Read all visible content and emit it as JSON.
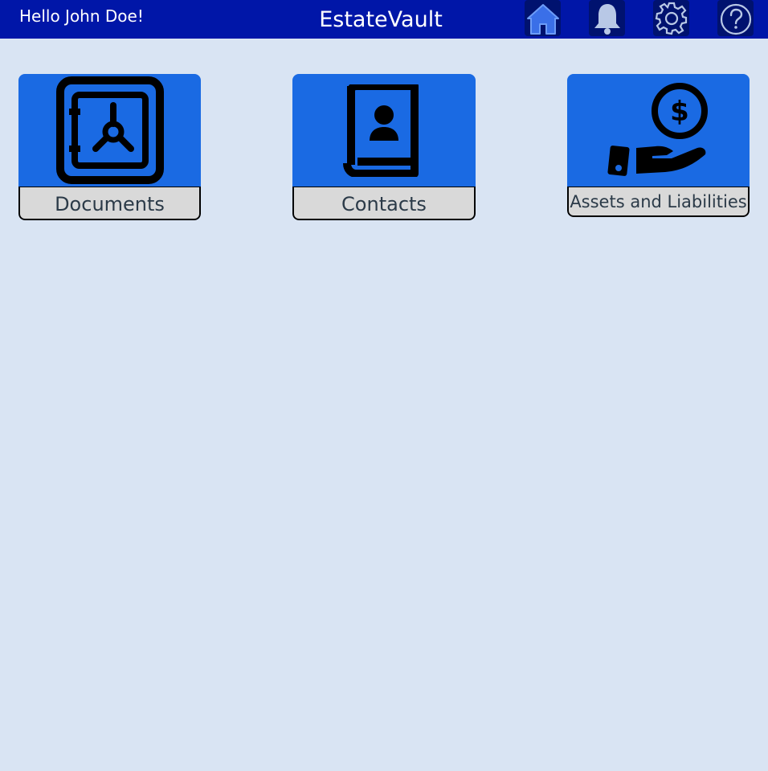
{
  "header": {
    "greeting": "Hello John Doe!",
    "title": "EstateVault",
    "buttons": [
      {
        "icon": "home-icon",
        "label": "Home"
      },
      {
        "icon": "bell-icon",
        "label": "Notifications"
      },
      {
        "icon": "gear-icon",
        "label": "Settings"
      },
      {
        "icon": "help-icon",
        "label": "Help"
      }
    ]
  },
  "cards": [
    {
      "label": "Documents",
      "icon": "safe-icon"
    },
    {
      "label": "Contacts",
      "icon": "contact-book-icon"
    },
    {
      "label": "Assets and Liabilities",
      "icon": "hand-coin-icon"
    }
  ],
  "colors": {
    "header_bg": "#0016a8",
    "page_bg": "#d9e4f3",
    "card_bg": "#1a6ae3",
    "label_bg": "#d9d9d9"
  }
}
